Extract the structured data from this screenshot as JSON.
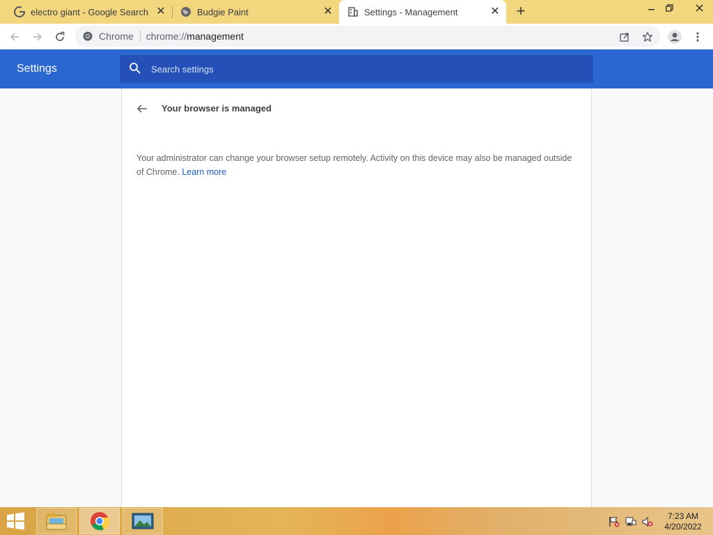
{
  "tabs": [
    {
      "title": "electro giant - Google Search",
      "favicon": "google-g-icon",
      "active": false
    },
    {
      "title": "Budgie Paint",
      "favicon": "globe-icon",
      "active": false
    },
    {
      "title": "Settings - Management",
      "favicon": "building-icon",
      "active": true
    }
  ],
  "omnibox": {
    "chip": "Chrome",
    "url_scheme": "chrome://",
    "url_host": "management"
  },
  "settings": {
    "title": "Settings",
    "search_placeholder": "Search settings"
  },
  "management": {
    "heading": "Your browser is managed",
    "description": "Your administrator can change your browser setup remotely. Activity on this device may also be managed outside of Chrome.",
    "learn_more": "Learn more"
  },
  "taskbar": {
    "apps": [
      "file-explorer-icon",
      "chrome-icon",
      "image-viewer-icon"
    ],
    "tray": [
      "action-center-flag-icon",
      "network-icon",
      "volume-muted-icon"
    ],
    "time": "7:23 AM",
    "date": "4/20/2022"
  },
  "colors": {
    "tabstrip": "#f3d77f",
    "settings_header": "#2b67d1",
    "search_box": "#2450b8",
    "link": "#1a5bc7"
  }
}
